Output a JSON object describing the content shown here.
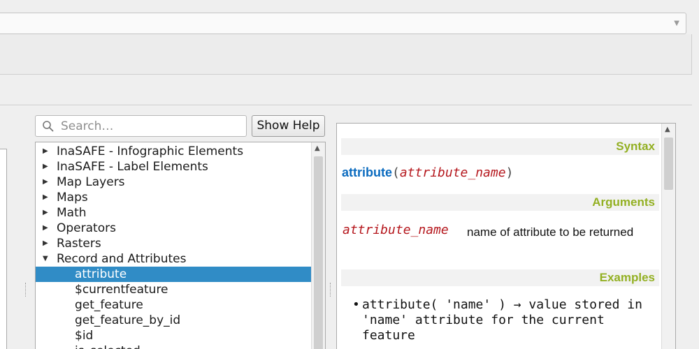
{
  "top_combo": {
    "value": ""
  },
  "search": {
    "placeholder": "Search…"
  },
  "show_help_button": "Show Help",
  "tree": {
    "groups": [
      {
        "label": "InaSAFE - Infographic Elements",
        "expanded": false
      },
      {
        "label": "InaSAFE - Label Elements",
        "expanded": false
      },
      {
        "label": "Map Layers",
        "expanded": false
      },
      {
        "label": "Maps",
        "expanded": false
      },
      {
        "label": "Math",
        "expanded": false
      },
      {
        "label": "Operators",
        "expanded": false
      },
      {
        "label": "Rasters",
        "expanded": false
      },
      {
        "label": "Record and Attributes",
        "expanded": true
      }
    ],
    "children": [
      {
        "label": "attribute",
        "selected": true
      },
      {
        "label": "$currentfeature",
        "selected": false
      },
      {
        "label": "get_feature",
        "selected": false
      },
      {
        "label": "get_feature_by_id",
        "selected": false
      },
      {
        "label": "$id",
        "selected": false
      },
      {
        "label": "is_selected",
        "selected": false
      }
    ]
  },
  "help": {
    "syntax_header": "Syntax",
    "function_name": "attribute",
    "open_paren": "(",
    "close_paren": ")",
    "syntax_arg": "attribute_name",
    "arguments_header": "Arguments",
    "arg_name": "attribute_name",
    "arg_description": "name of attribute to be returned",
    "examples_header": "Examples",
    "example_text": "attribute( 'name' ) → value stored in 'name' attribute for the current feature"
  },
  "colors": {
    "selection": "#308cc6",
    "section_header": "#93b023",
    "function": "#0b6bbf",
    "argument": "#b5171d"
  }
}
